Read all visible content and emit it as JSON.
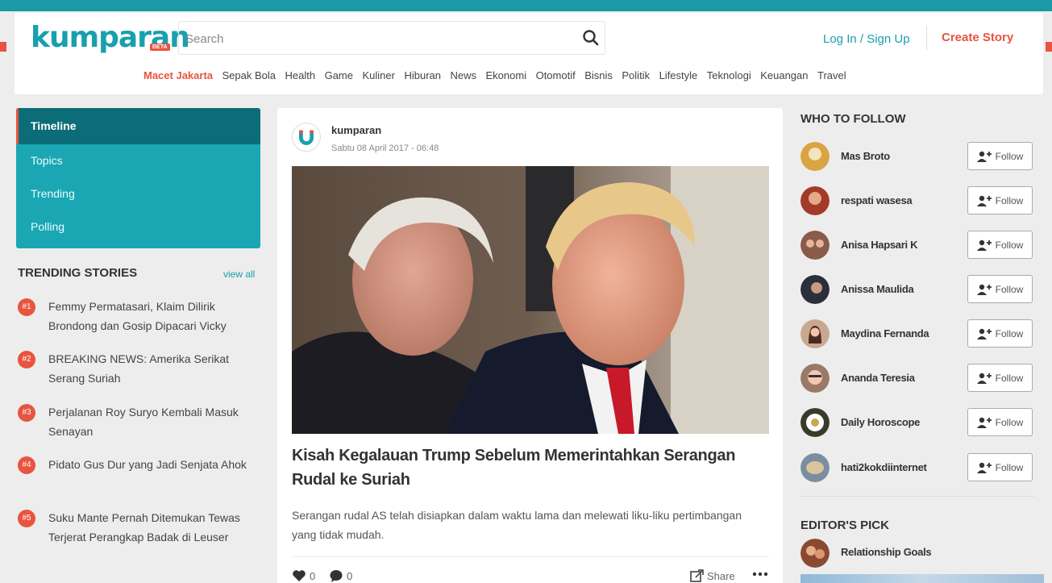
{
  "header": {
    "logo_text": "kumparan",
    "logo_badge": "BETA",
    "search_placeholder": "Search",
    "login_label": "Log In / Sign Up",
    "create_label": "Create Story",
    "nav": [
      {
        "label": "Macet Jakarta",
        "active": true
      },
      {
        "label": "Sepak Bola"
      },
      {
        "label": "Health"
      },
      {
        "label": "Game"
      },
      {
        "label": "Kuliner"
      },
      {
        "label": "Hiburan"
      },
      {
        "label": "News"
      },
      {
        "label": "Ekonomi"
      },
      {
        "label": "Otomotif"
      },
      {
        "label": "Bisnis"
      },
      {
        "label": "Politik"
      },
      {
        "label": "Lifestyle"
      },
      {
        "label": "Teknologi"
      },
      {
        "label": "Keuangan"
      },
      {
        "label": "Travel"
      }
    ]
  },
  "sidebar": {
    "menu": [
      {
        "label": "Timeline",
        "active": true
      },
      {
        "label": "Topics"
      },
      {
        "label": "Trending"
      },
      {
        "label": "Polling"
      }
    ],
    "trending_title": "TRENDING STORIES",
    "view_all": "view all",
    "trending": [
      {
        "num": "#1",
        "text": "Femmy Permatasari, Klaim Dilirik Brondong dan Gosip Dipacari Vicky"
      },
      {
        "num": "#2",
        "text": "BREAKING NEWS: Amerika Serikat Serang Suriah"
      },
      {
        "num": "#3",
        "text": "Perjalanan Roy Suryo Kembali Masuk Senayan"
      },
      {
        "num": "#4",
        "text": "Pidato Gus Dur yang Jadi Senjata Ahok"
      },
      {
        "num": "#5",
        "text": "Suku Mante Pernah Ditemukan Tewas Terjerat Perangkap Badak di Leuser"
      }
    ]
  },
  "story": {
    "author": "kumparan",
    "date": "Sabtu 08 April 2017 - 06:48",
    "headline": "Kisah Kegalauan Trump Sebelum Memerintahkan Serangan Rudal ke Suriah",
    "summary": "Serangan rudal AS telah disiapkan dalam waktu lama dan melewati liku-liku pertimbangan yang tidak mudah.",
    "likes": "0",
    "comments": "0",
    "share_label": "Share"
  },
  "right": {
    "who_to_follow_title": "WHO TO FOLLOW",
    "follow_label": "Follow",
    "people": [
      {
        "name": "Mas Broto",
        "color": "#d9a441"
      },
      {
        "name": "respati wasesa",
        "color": "#a33a2a"
      },
      {
        "name": "Anisa Hapsari K",
        "color": "#8a5a4a"
      },
      {
        "name": "Anissa Maulida",
        "color": "#2a2f3a"
      },
      {
        "name": "Maydina Fernanda",
        "color": "#c9a892"
      },
      {
        "name": "Ananda Teresia",
        "color": "#9a7a66"
      },
      {
        "name": "Daily Horoscope",
        "color": "#3a3a2a"
      },
      {
        "name": "hati2kokdiinternet",
        "color": "#7a8ea0"
      }
    ],
    "editors_pick_title": "EDITOR'S PICK",
    "editors_pick": {
      "name": "Relationship Goals"
    }
  },
  "colors": {
    "brand": "#18a0ad",
    "accent": "#e8543f",
    "menu_active": "#0c6c78"
  }
}
